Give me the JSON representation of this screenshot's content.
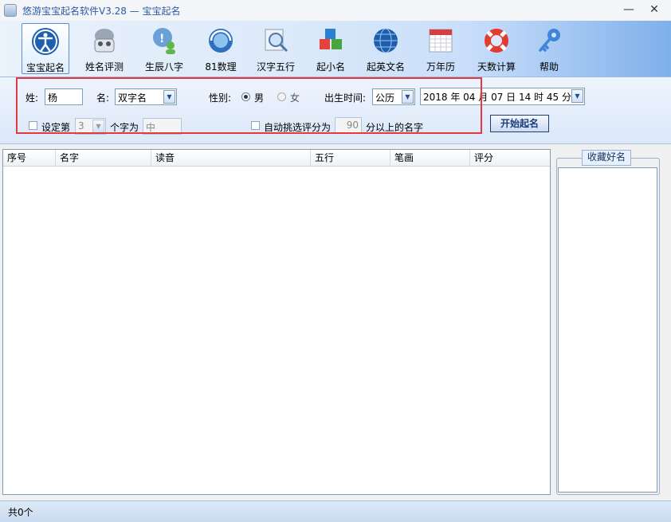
{
  "window": {
    "title": "悠游宝宝起名软件V3.28  —  宝宝起名",
    "minimize": "—",
    "close": "✕"
  },
  "toolbar": {
    "items": [
      {
        "label": "宝宝起名",
        "icon": "accessibility-person-icon",
        "active": true
      },
      {
        "label": "姓名评测",
        "icon": "people-group-icon"
      },
      {
        "label": "生辰八字",
        "icon": "chat-person-icon"
      },
      {
        "label": "81数理",
        "icon": "refresh-globe-icon"
      },
      {
        "label": "汉字五行",
        "icon": "magnifier-document-icon"
      },
      {
        "label": "起小名",
        "icon": "color-cubes-icon"
      },
      {
        "label": "起英文名",
        "icon": "globe-icon"
      },
      {
        "label": "万年历",
        "icon": "calendar-icon"
      },
      {
        "label": "天数计算",
        "icon": "lifebuoy-icon"
      },
      {
        "label": "帮助",
        "icon": "key-icon"
      }
    ]
  },
  "form": {
    "surname_label": "姓:",
    "surname_value": "杨",
    "name_label": "名:",
    "name_type_value": "双字名",
    "gender_label": "性别:",
    "gender_male": "男",
    "gender_female": "女",
    "birth_label": "出生时间:",
    "calendar_value": "公历",
    "birth_datetime": "2018 年 04 月 07 日  14 时 45 分",
    "set_char_label": "设定第",
    "char_pos_value": "3",
    "char_is_label": "个字为",
    "char_value": "中",
    "auto_pick_label": "自动挑选评分为",
    "score_value": "90",
    "score_suffix": "分以上的名字",
    "start_button": "开始起名"
  },
  "table": {
    "columns": [
      "序号",
      "名字",
      "读音",
      "五行",
      "笔画",
      "评分"
    ],
    "rows": []
  },
  "favorites": {
    "title": "收藏好名"
  },
  "status": {
    "text": "共0个"
  },
  "colors": {
    "highlight_border": "#e33a3f",
    "title_text": "#2b5ba8",
    "toolbar_gradient_end": "#7fb0ea"
  }
}
